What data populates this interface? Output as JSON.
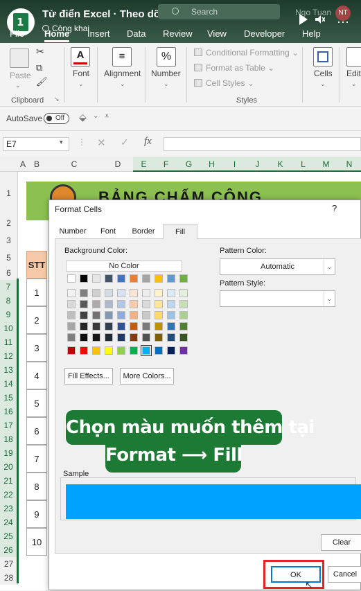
{
  "header": {
    "title": "Từ điển Excel · Theo dõi",
    "subtitle": "Công khai",
    "search_placeholder": "Search",
    "user_name": "Ngo Tuan",
    "avatar_initials": "NT"
  },
  "ribbon_tabs": [
    "File",
    "Home",
    "Insert",
    "Data",
    "Review",
    "View",
    "Developer",
    "Help"
  ],
  "active_tab": "Home",
  "ribbon": {
    "paste_label": "Paste",
    "clipboard_label": "Clipboard",
    "font_label": "Font",
    "alignment_label": "Alignment",
    "number_label": "Number",
    "conditional_formatting": "Conditional Formatting",
    "format_as_table": "Format as Table",
    "cell_styles": "Cell Styles",
    "styles_label": "Styles",
    "cells_label": "Cells",
    "editing_label": "Editi"
  },
  "autosave": {
    "label": "AutoSave",
    "state": "Off"
  },
  "formula_bar": {
    "name_box": "E7",
    "fx": "fx"
  },
  "columns": [
    "A",
    "B",
    "C",
    "D",
    "E",
    "F",
    "G",
    "H",
    "I",
    "J",
    "K",
    "L",
    "M",
    "N"
  ],
  "rows": [
    "1",
    "2",
    "3",
    "5",
    "6",
    "7",
    "8",
    "9",
    "10",
    "11",
    "12",
    "13",
    "14",
    "15",
    "16",
    "17",
    "18",
    "19",
    "20",
    "21",
    "22",
    "23",
    "24",
    "25",
    "26",
    "27",
    "28"
  ],
  "sheet": {
    "banner_title": "BẢNG CHẤM CÔNG",
    "stt_header": "STT",
    "stt_values": [
      "1",
      "2",
      "3",
      "4",
      "5",
      "6",
      "7",
      "8",
      "9",
      "10"
    ]
  },
  "dialog": {
    "title": "Format Cells",
    "help": "?",
    "tabs": [
      "Number",
      "Font",
      "Border",
      "Fill"
    ],
    "active_tab": "Fill",
    "background_color_label": "Background Color:",
    "no_color": "No Color",
    "pattern_color_label": "Pattern Color:",
    "pattern_color_value": "Automatic",
    "pattern_style_label": "Pattern Style:",
    "fill_effects": "Fill Effects...",
    "more_colors": "More Colors...",
    "sample_label": "Sample",
    "sample_color": "#00a2ff",
    "clear": "Clear",
    "ok": "OK",
    "cancel": "Cancel"
  },
  "palette": {
    "theme_top": [
      "#ffffff",
      "#000000",
      "#e7e6e6",
      "#44546a",
      "#4472c4",
      "#ed7d31",
      "#a5a5a5",
      "#ffc000",
      "#5b9bd5",
      "#70ad47"
    ],
    "tints": [
      [
        "#f2f2f2",
        "#808080",
        "#d0cece",
        "#d6dce4",
        "#d9e2f3",
        "#fbe5d6",
        "#ededed",
        "#fff2cc",
        "#deebf7",
        "#e2efda"
      ],
      [
        "#d9d9d9",
        "#595959",
        "#aeaaaa",
        "#adb9ca",
        "#b4c7e7",
        "#f8cbad",
        "#dbdbdb",
        "#ffe699",
        "#bdd7ee",
        "#c5e0b4"
      ],
      [
        "#bfbfbf",
        "#404040",
        "#757171",
        "#8497b0",
        "#8faadc",
        "#f4b183",
        "#c9c9c9",
        "#ffd966",
        "#9dc3e6",
        "#a9d18e"
      ],
      [
        "#a6a6a6",
        "#262626",
        "#3b3838",
        "#323f4f",
        "#2f5597",
        "#c55a11",
        "#7b7b7b",
        "#bf9000",
        "#2e75b6",
        "#548235"
      ],
      [
        "#7f7f7f",
        "#0d0d0d",
        "#171616",
        "#222a35",
        "#1f3864",
        "#843c0c",
        "#525252",
        "#7f6000",
        "#1f4e79",
        "#375623"
      ]
    ],
    "standard": [
      "#c00000",
      "#ff0000",
      "#ffc000",
      "#ffff00",
      "#92d050",
      "#00b050",
      "#00b0f0",
      "#0070c0",
      "#002060",
      "#7030a0"
    ],
    "selected_standard_index": 6
  },
  "overlay": {
    "line1": "Chọn màu muốn thêm tại",
    "line2": "Format ⟶ Fill"
  }
}
